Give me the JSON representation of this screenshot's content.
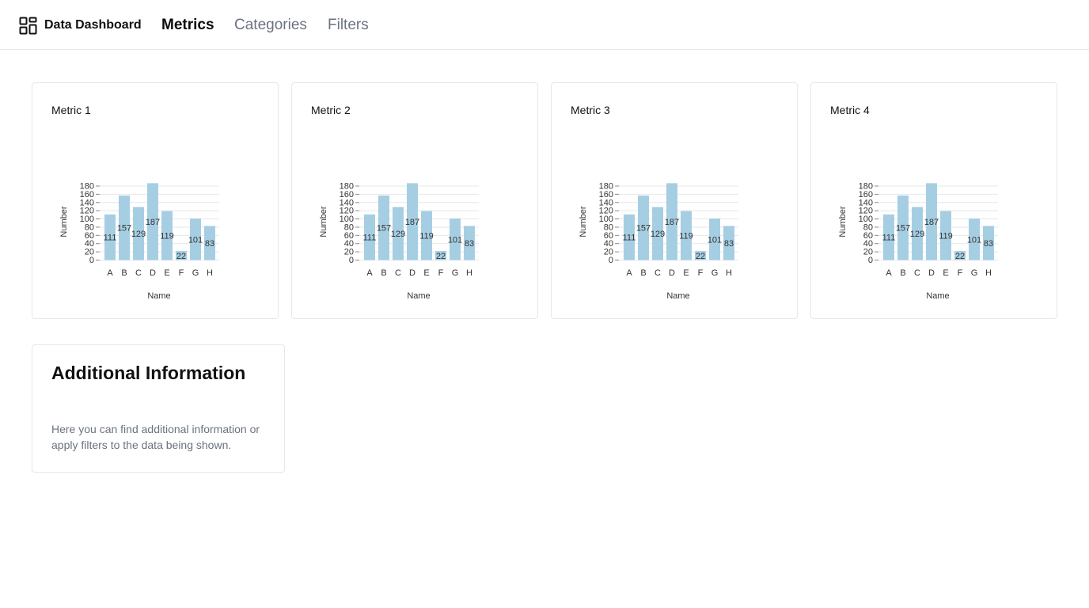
{
  "header": {
    "app_title": "Data Dashboard",
    "brand_icon": "dashboard-grid-icon",
    "tabs": [
      {
        "label": "Metrics",
        "active": true
      },
      {
        "label": "Categories",
        "active": false
      },
      {
        "label": "Filters",
        "active": false
      }
    ]
  },
  "colors": {
    "bar": "#a6cee3",
    "gridline": "#e5e7eb",
    "muted_text": "#6b7280",
    "border": "#e5e7eb"
  },
  "cards": [
    {
      "title": "Metric 1"
    },
    {
      "title": "Metric 2"
    },
    {
      "title": "Metric 3"
    },
    {
      "title": "Metric 4"
    }
  ],
  "info": {
    "title": "Additional Information",
    "text": "Here you can find additional information or apply filters to the data being shown."
  },
  "chart_data": [
    {
      "type": "bar",
      "title": "Metric 1",
      "xlabel": "Name",
      "ylabel": "Number",
      "categories": [
        "A",
        "B",
        "C",
        "D",
        "E",
        "F",
        "G",
        "H"
      ],
      "values": [
        111,
        157,
        129,
        187,
        119,
        22,
        101,
        83
      ],
      "ylim": [
        0,
        180
      ],
      "yticks": [
        0,
        20,
        40,
        60,
        80,
        100,
        120,
        140,
        160,
        180
      ],
      "grid": true
    },
    {
      "type": "bar",
      "title": "Metric 2",
      "xlabel": "Name",
      "ylabel": "Number",
      "categories": [
        "A",
        "B",
        "C",
        "D",
        "E",
        "F",
        "G",
        "H"
      ],
      "values": [
        111,
        157,
        129,
        187,
        119,
        22,
        101,
        83
      ],
      "ylim": [
        0,
        180
      ],
      "yticks": [
        0,
        20,
        40,
        60,
        80,
        100,
        120,
        140,
        160,
        180
      ],
      "grid": true
    },
    {
      "type": "bar",
      "title": "Metric 3",
      "xlabel": "Name",
      "ylabel": "Number",
      "categories": [
        "A",
        "B",
        "C",
        "D",
        "E",
        "F",
        "G",
        "H"
      ],
      "values": [
        111,
        157,
        129,
        187,
        119,
        22,
        101,
        83
      ],
      "ylim": [
        0,
        180
      ],
      "yticks": [
        0,
        20,
        40,
        60,
        80,
        100,
        120,
        140,
        160,
        180
      ],
      "grid": true
    },
    {
      "type": "bar",
      "title": "Metric 4",
      "xlabel": "Name",
      "ylabel": "Number",
      "categories": [
        "A",
        "B",
        "C",
        "D",
        "E",
        "F",
        "G",
        "H"
      ],
      "values": [
        111,
        157,
        129,
        187,
        119,
        22,
        101,
        83
      ],
      "ylim": [
        0,
        180
      ],
      "yticks": [
        0,
        20,
        40,
        60,
        80,
        100,
        120,
        140,
        160,
        180
      ],
      "grid": true
    }
  ]
}
